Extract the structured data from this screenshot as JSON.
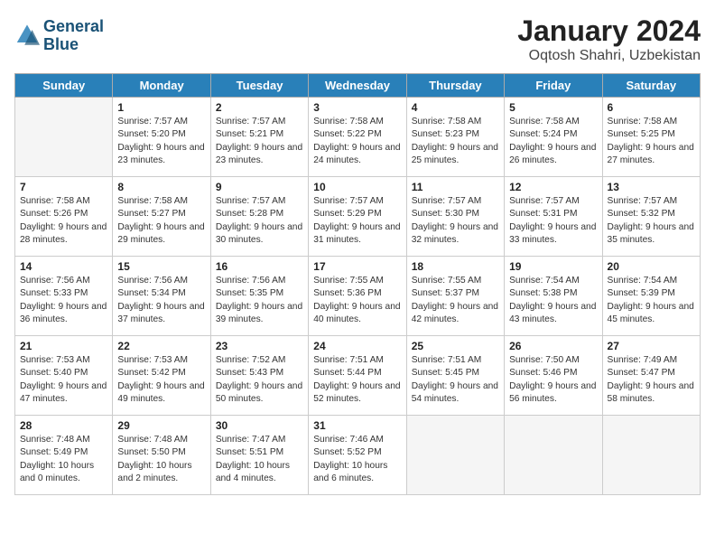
{
  "header": {
    "logo_line1": "General",
    "logo_line2": "Blue",
    "title": "January 2024",
    "subtitle": "Oqtosh Shahri, Uzbekistan"
  },
  "weekdays": [
    "Sunday",
    "Monday",
    "Tuesday",
    "Wednesday",
    "Thursday",
    "Friday",
    "Saturday"
  ],
  "weeks": [
    [
      {
        "day": "",
        "sunrise": "",
        "sunset": "",
        "daylight": ""
      },
      {
        "day": "1",
        "sunrise": "Sunrise: 7:57 AM",
        "sunset": "Sunset: 5:20 PM",
        "daylight": "Daylight: 9 hours and 23 minutes."
      },
      {
        "day": "2",
        "sunrise": "Sunrise: 7:57 AM",
        "sunset": "Sunset: 5:21 PM",
        "daylight": "Daylight: 9 hours and 23 minutes."
      },
      {
        "day": "3",
        "sunrise": "Sunrise: 7:58 AM",
        "sunset": "Sunset: 5:22 PM",
        "daylight": "Daylight: 9 hours and 24 minutes."
      },
      {
        "day": "4",
        "sunrise": "Sunrise: 7:58 AM",
        "sunset": "Sunset: 5:23 PM",
        "daylight": "Daylight: 9 hours and 25 minutes."
      },
      {
        "day": "5",
        "sunrise": "Sunrise: 7:58 AM",
        "sunset": "Sunset: 5:24 PM",
        "daylight": "Daylight: 9 hours and 26 minutes."
      },
      {
        "day": "6",
        "sunrise": "Sunrise: 7:58 AM",
        "sunset": "Sunset: 5:25 PM",
        "daylight": "Daylight: 9 hours and 27 minutes."
      }
    ],
    [
      {
        "day": "7",
        "sunrise": "Sunrise: 7:58 AM",
        "sunset": "Sunset: 5:26 PM",
        "daylight": "Daylight: 9 hours and 28 minutes."
      },
      {
        "day": "8",
        "sunrise": "Sunrise: 7:58 AM",
        "sunset": "Sunset: 5:27 PM",
        "daylight": "Daylight: 9 hours and 29 minutes."
      },
      {
        "day": "9",
        "sunrise": "Sunrise: 7:57 AM",
        "sunset": "Sunset: 5:28 PM",
        "daylight": "Daylight: 9 hours and 30 minutes."
      },
      {
        "day": "10",
        "sunrise": "Sunrise: 7:57 AM",
        "sunset": "Sunset: 5:29 PM",
        "daylight": "Daylight: 9 hours and 31 minutes."
      },
      {
        "day": "11",
        "sunrise": "Sunrise: 7:57 AM",
        "sunset": "Sunset: 5:30 PM",
        "daylight": "Daylight: 9 hours and 32 minutes."
      },
      {
        "day": "12",
        "sunrise": "Sunrise: 7:57 AM",
        "sunset": "Sunset: 5:31 PM",
        "daylight": "Daylight: 9 hours and 33 minutes."
      },
      {
        "day": "13",
        "sunrise": "Sunrise: 7:57 AM",
        "sunset": "Sunset: 5:32 PM",
        "daylight": "Daylight: 9 hours and 35 minutes."
      }
    ],
    [
      {
        "day": "14",
        "sunrise": "Sunrise: 7:56 AM",
        "sunset": "Sunset: 5:33 PM",
        "daylight": "Daylight: 9 hours and 36 minutes."
      },
      {
        "day": "15",
        "sunrise": "Sunrise: 7:56 AM",
        "sunset": "Sunset: 5:34 PM",
        "daylight": "Daylight: 9 hours and 37 minutes."
      },
      {
        "day": "16",
        "sunrise": "Sunrise: 7:56 AM",
        "sunset": "Sunset: 5:35 PM",
        "daylight": "Daylight: 9 hours and 39 minutes."
      },
      {
        "day": "17",
        "sunrise": "Sunrise: 7:55 AM",
        "sunset": "Sunset: 5:36 PM",
        "daylight": "Daylight: 9 hours and 40 minutes."
      },
      {
        "day": "18",
        "sunrise": "Sunrise: 7:55 AM",
        "sunset": "Sunset: 5:37 PM",
        "daylight": "Daylight: 9 hours and 42 minutes."
      },
      {
        "day": "19",
        "sunrise": "Sunrise: 7:54 AM",
        "sunset": "Sunset: 5:38 PM",
        "daylight": "Daylight: 9 hours and 43 minutes."
      },
      {
        "day": "20",
        "sunrise": "Sunrise: 7:54 AM",
        "sunset": "Sunset: 5:39 PM",
        "daylight": "Daylight: 9 hours and 45 minutes."
      }
    ],
    [
      {
        "day": "21",
        "sunrise": "Sunrise: 7:53 AM",
        "sunset": "Sunset: 5:40 PM",
        "daylight": "Daylight: 9 hours and 47 minutes."
      },
      {
        "day": "22",
        "sunrise": "Sunrise: 7:53 AM",
        "sunset": "Sunset: 5:42 PM",
        "daylight": "Daylight: 9 hours and 49 minutes."
      },
      {
        "day": "23",
        "sunrise": "Sunrise: 7:52 AM",
        "sunset": "Sunset: 5:43 PM",
        "daylight": "Daylight: 9 hours and 50 minutes."
      },
      {
        "day": "24",
        "sunrise": "Sunrise: 7:51 AM",
        "sunset": "Sunset: 5:44 PM",
        "daylight": "Daylight: 9 hours and 52 minutes."
      },
      {
        "day": "25",
        "sunrise": "Sunrise: 7:51 AM",
        "sunset": "Sunset: 5:45 PM",
        "daylight": "Daylight: 9 hours and 54 minutes."
      },
      {
        "day": "26",
        "sunrise": "Sunrise: 7:50 AM",
        "sunset": "Sunset: 5:46 PM",
        "daylight": "Daylight: 9 hours and 56 minutes."
      },
      {
        "day": "27",
        "sunrise": "Sunrise: 7:49 AM",
        "sunset": "Sunset: 5:47 PM",
        "daylight": "Daylight: 9 hours and 58 minutes."
      }
    ],
    [
      {
        "day": "28",
        "sunrise": "Sunrise: 7:48 AM",
        "sunset": "Sunset: 5:49 PM",
        "daylight": "Daylight: 10 hours and 0 minutes."
      },
      {
        "day": "29",
        "sunrise": "Sunrise: 7:48 AM",
        "sunset": "Sunset: 5:50 PM",
        "daylight": "Daylight: 10 hours and 2 minutes."
      },
      {
        "day": "30",
        "sunrise": "Sunrise: 7:47 AM",
        "sunset": "Sunset: 5:51 PM",
        "daylight": "Daylight: 10 hours and 4 minutes."
      },
      {
        "day": "31",
        "sunrise": "Sunrise: 7:46 AM",
        "sunset": "Sunset: 5:52 PM",
        "daylight": "Daylight: 10 hours and 6 minutes."
      },
      {
        "day": "",
        "sunrise": "",
        "sunset": "",
        "daylight": ""
      },
      {
        "day": "",
        "sunrise": "",
        "sunset": "",
        "daylight": ""
      },
      {
        "day": "",
        "sunrise": "",
        "sunset": "",
        "daylight": ""
      }
    ]
  ]
}
